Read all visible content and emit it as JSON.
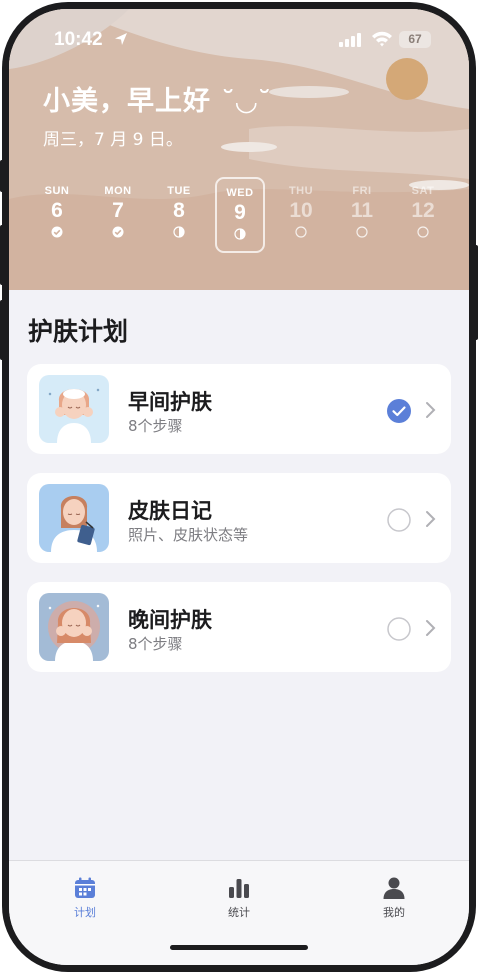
{
  "status": {
    "time": "10:42",
    "battery": "67"
  },
  "header": {
    "greeting": "小美，早上好 ˘◡˘",
    "date": "周三，7 月 9 日。"
  },
  "week": [
    {
      "name": "SUN",
      "num": "6",
      "status": "done"
    },
    {
      "name": "MON",
      "num": "7",
      "status": "done"
    },
    {
      "name": "TUE",
      "num": "8",
      "status": "half"
    },
    {
      "name": "WED",
      "num": "9",
      "status": "half",
      "selected": true
    },
    {
      "name": "THU",
      "num": "10",
      "status": "empty"
    },
    {
      "name": "FRI",
      "num": "11",
      "status": "empty"
    },
    {
      "name": "SAT",
      "num": "12",
      "status": "empty"
    }
  ],
  "section": {
    "title": "护肤计划"
  },
  "plans": [
    {
      "title": "早间护肤",
      "subtitle": "8个步骤",
      "checked": true
    },
    {
      "title": "皮肤日记",
      "subtitle": "照片、皮肤状态等",
      "checked": false
    },
    {
      "title": "晚间护肤",
      "subtitle": "8个步骤",
      "checked": false
    }
  ],
  "tabs": [
    {
      "label": "计划",
      "icon": "calendar-icon",
      "active": true
    },
    {
      "label": "统计",
      "icon": "bar-chart-icon",
      "active": false
    },
    {
      "label": "我的",
      "icon": "person-icon",
      "active": false
    }
  ],
  "colors": {
    "accent": "#5b7fd8",
    "header": "#d6bcab",
    "avatar": "#d4a877",
    "inactive": "#4a4a4f"
  }
}
